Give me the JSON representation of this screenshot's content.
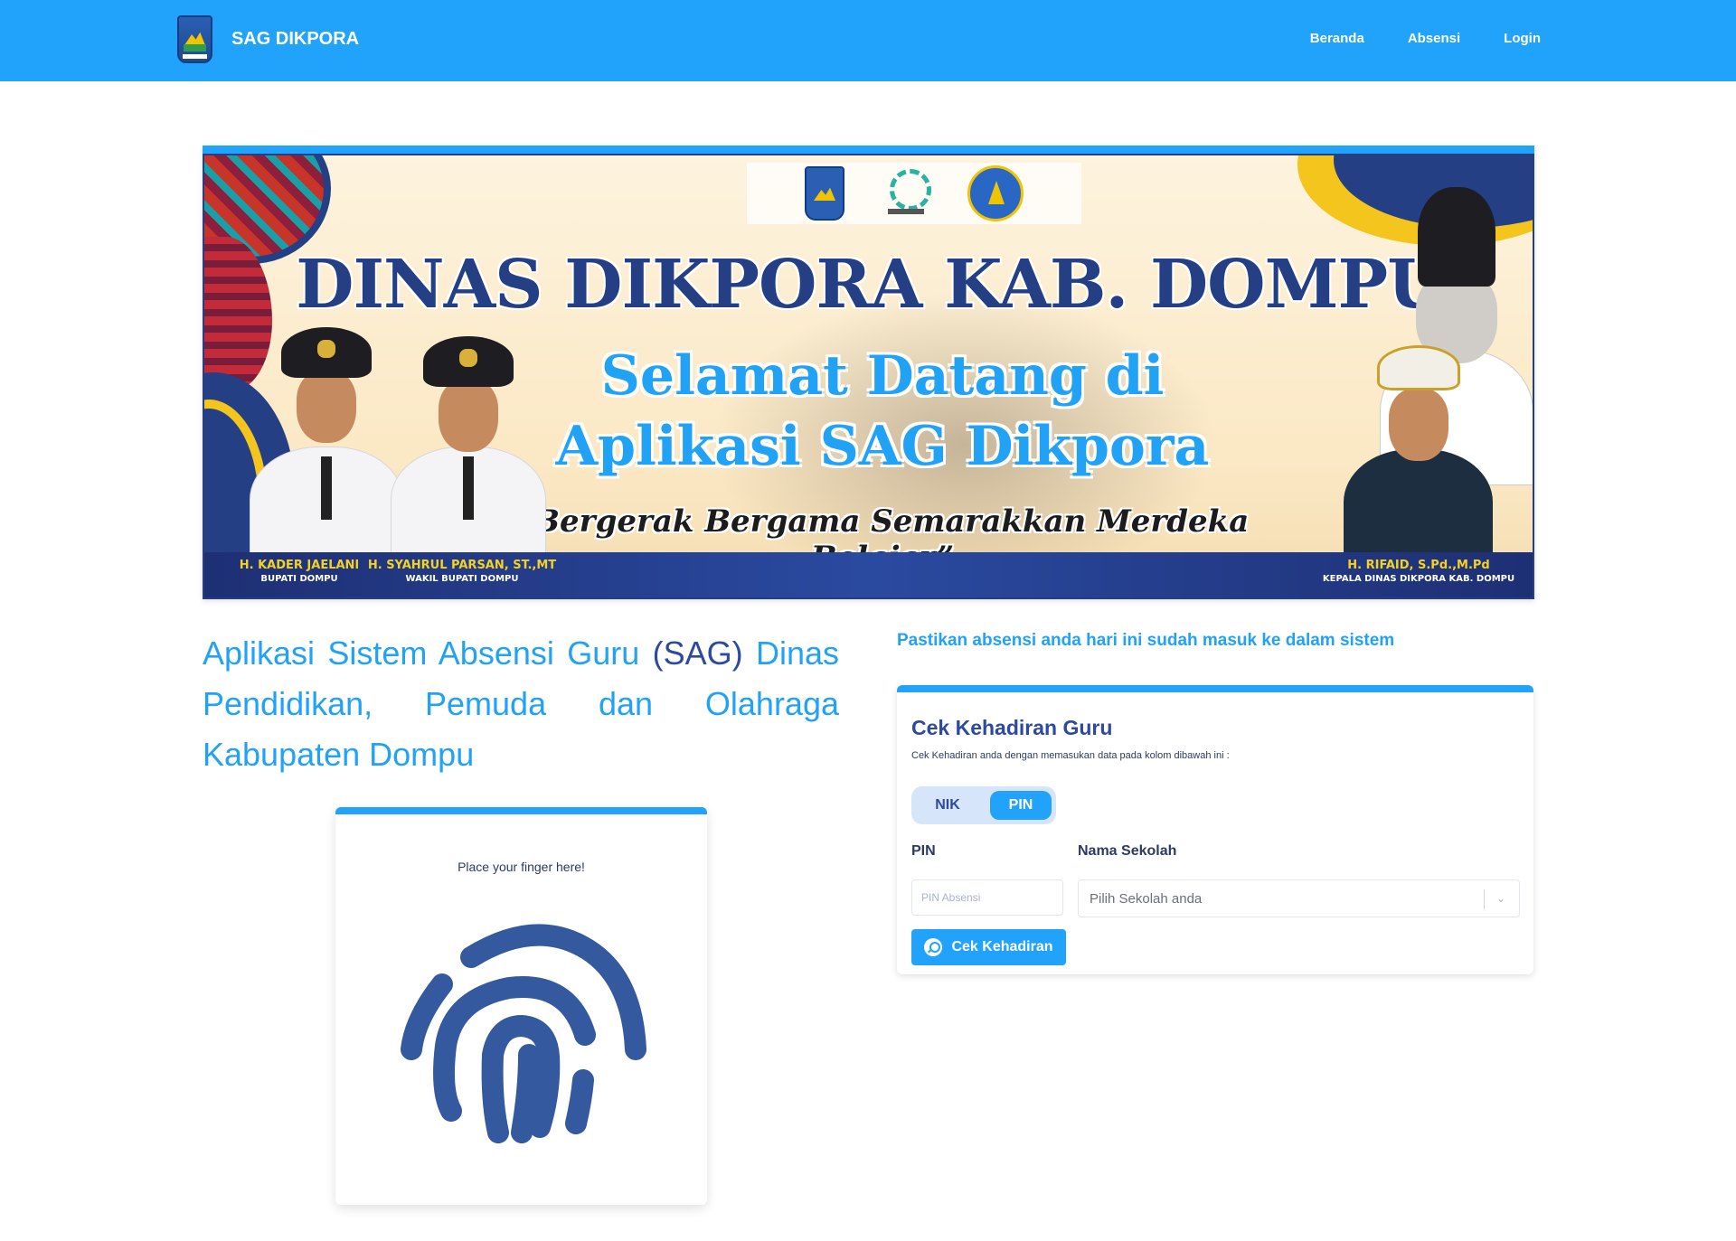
{
  "navbar": {
    "brand": "SAG DIKPORA",
    "links": [
      "Beranda",
      "Absensi",
      "Login"
    ],
    "accent": "#21a3fb"
  },
  "banner": {
    "title": "DINAS DIKPORA KAB. DOMPU",
    "welcome_line1": "Selamat Datang di",
    "welcome_line2": "Aplikasi SAG Dikpora",
    "motto": "“Bergerak Bergama Semarakkan Merdeka Belajar”",
    "officials": [
      {
        "name": "H. KADER JAELANI",
        "role": "BUPATI DOMPU"
      },
      {
        "name": "H. SYAHRUL PARSAN, ST.,MT",
        "role": "WAKIL BUPATI DOMPU"
      },
      {
        "name": "H. RIFAID, S.Pd.,M.Pd",
        "role": "KEPALA DINAS DIKPORA KAB. DOMPU"
      }
    ]
  },
  "intro": {
    "part1": "Aplikasi Sistem Absensi Guru ",
    "abbr": "(SAG)",
    "part2": " Dinas Pendidikan, Pemuda dan Olahraga Kabupaten Dompu"
  },
  "fingerprint": {
    "hint": "Place your finger here!",
    "icon": "fingerprint-icon"
  },
  "check": {
    "notice": "Pastikan absensi anda hari ini sudah masuk ke dalam sistem",
    "title": "Cek Kehadiran Guru",
    "subtitle": "Cek Kehadiran anda dengan memasukan data pada kolom dibawah ini :",
    "toggle": {
      "nik": "NIK",
      "pin": "PIN",
      "selected": "PIN"
    },
    "pin_label": "PIN",
    "pin_placeholder": "PIN Absensi",
    "pin_value": "",
    "school_label": "Nama Sekolah",
    "school_placeholder": "Pilih Sekolah anda",
    "button": "Cek Kehadiran"
  }
}
